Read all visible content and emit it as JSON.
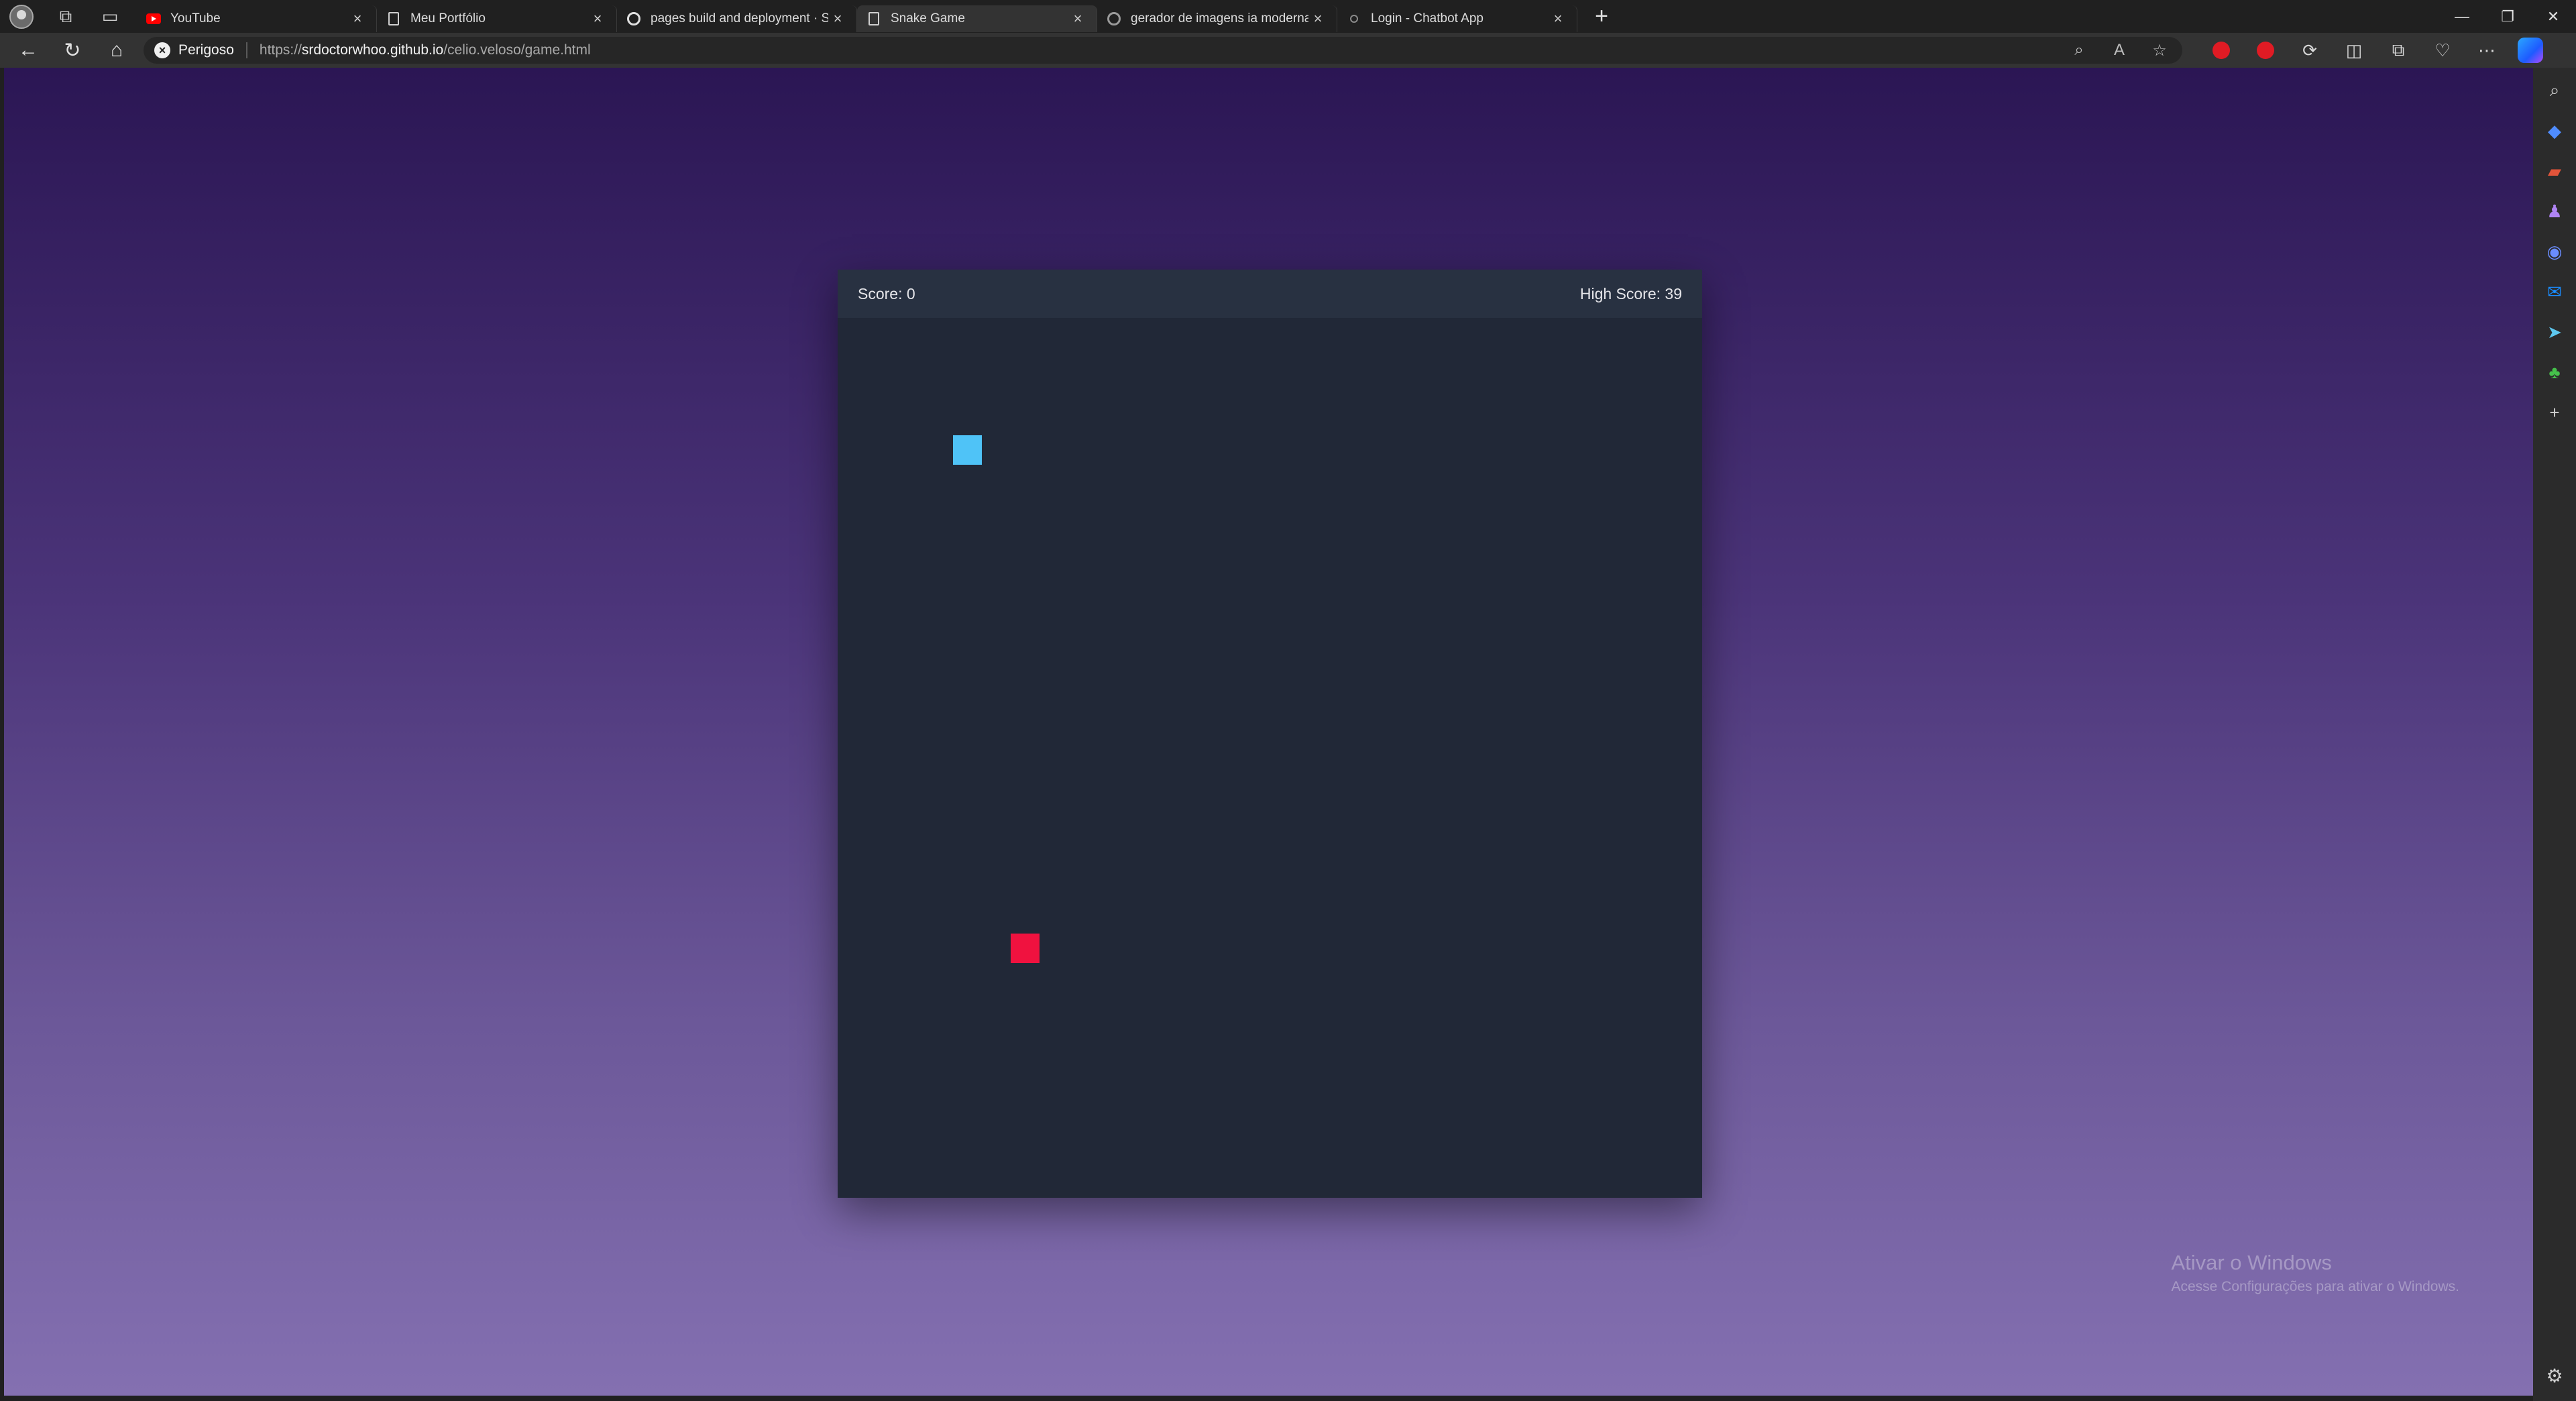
{
  "browser": {
    "tabs": [
      {
        "title": "YouTube",
        "favicon": "youtube-icon",
        "active": false
      },
      {
        "title": "Meu Portfólio",
        "favicon": "document-icon",
        "active": false
      },
      {
        "title": "pages build and deployment · Sr",
        "favicon": "github-icon",
        "active": false
      },
      {
        "title": "Snake Game",
        "favicon": "document-icon",
        "active": true
      },
      {
        "title": "gerador de imagens ia moderna",
        "favicon": "google-icon",
        "active": false
      },
      {
        "title": "Login - Chatbot App",
        "favicon": "loading-icon",
        "active": false
      }
    ],
    "close_glyph": "×",
    "new_tab_glyph": "+",
    "security_label": "Perigoso",
    "url_prefix": "https://",
    "url_host": "srdoctorwhoo.github.io",
    "url_path": "/celio.veloso/game.html"
  },
  "game": {
    "score_text": "Score: 0",
    "high_score_text": "High Score: 39",
    "grid": {
      "cols": 30,
      "rows": 30
    },
    "snake": [
      {
        "col": 4,
        "row": 4
      }
    ],
    "food": {
      "col": 6,
      "row": 21
    },
    "colors": {
      "snake": "#4fc3f7",
      "food": "#f0123f",
      "board": "#212837",
      "scorebar": "#283141"
    }
  },
  "watermark": {
    "title": "Ativar o Windows",
    "subtitle": "Acesse Configurações para ativar o Windows."
  }
}
